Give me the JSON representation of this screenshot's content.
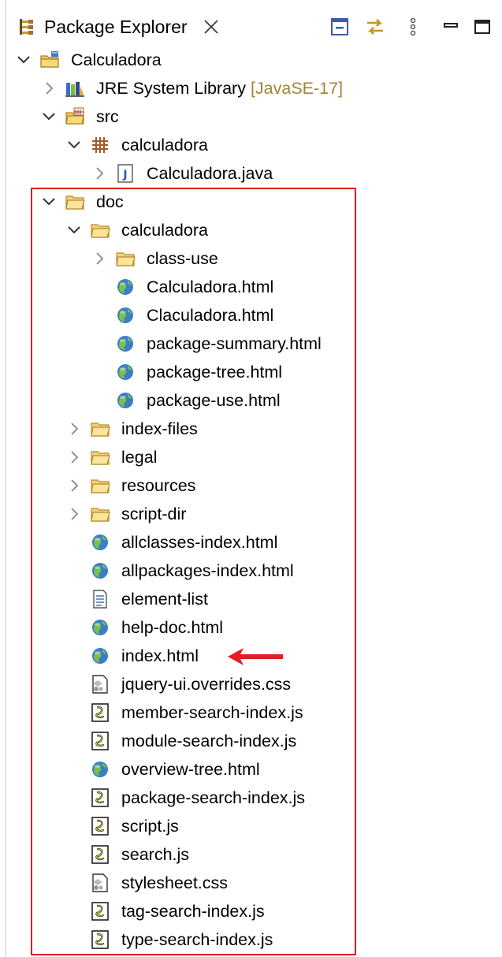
{
  "header": {
    "title": "Package Explorer",
    "icons": [
      "package-explorer-icon",
      "close-icon",
      "collapse-all-icon",
      "link-with-editor-icon",
      "view-menu-icon",
      "minimize-icon",
      "maximize-icon"
    ]
  },
  "tree": [
    {
      "level": 0,
      "expand": "down",
      "icon": "project",
      "label": "Calculadora"
    },
    {
      "level": 1,
      "expand": "right",
      "icon": "library",
      "label": "JRE System Library",
      "decoration": "[JavaSE-17]"
    },
    {
      "level": 1,
      "expand": "down",
      "icon": "src-folder",
      "label": "src"
    },
    {
      "level": 2,
      "expand": "down",
      "icon": "package",
      "label": "calculadora"
    },
    {
      "level": 3,
      "expand": "right",
      "icon": "java",
      "label": "Calculadora.java"
    },
    {
      "level": 1,
      "expand": "down",
      "icon": "folder",
      "label": "doc"
    },
    {
      "level": 2,
      "expand": "down",
      "icon": "folder",
      "label": "calculadora"
    },
    {
      "level": 3,
      "expand": "right",
      "icon": "folder",
      "label": "class-use"
    },
    {
      "level": 3,
      "expand": "",
      "icon": "globe",
      "label": "Calculadora.html"
    },
    {
      "level": 3,
      "expand": "",
      "icon": "globe",
      "label": "Claculadora.html"
    },
    {
      "level": 3,
      "expand": "",
      "icon": "globe",
      "label": "package-summary.html"
    },
    {
      "level": 3,
      "expand": "",
      "icon": "globe",
      "label": "package-tree.html"
    },
    {
      "level": 3,
      "expand": "",
      "icon": "globe",
      "label": "package-use.html"
    },
    {
      "level": 2,
      "expand": "right",
      "icon": "folder",
      "label": "index-files"
    },
    {
      "level": 2,
      "expand": "right",
      "icon": "folder",
      "label": "legal"
    },
    {
      "level": 2,
      "expand": "right",
      "icon": "folder",
      "label": "resources"
    },
    {
      "level": 2,
      "expand": "right",
      "icon": "folder",
      "label": "script-dir"
    },
    {
      "level": 2,
      "expand": "",
      "icon": "globe",
      "label": "allclasses-index.html"
    },
    {
      "level": 2,
      "expand": "",
      "icon": "globe",
      "label": "allpackages-index.html"
    },
    {
      "level": 2,
      "expand": "",
      "icon": "text-file",
      "label": "element-list"
    },
    {
      "level": 2,
      "expand": "",
      "icon": "globe",
      "label": "help-doc.html"
    },
    {
      "level": 2,
      "expand": "",
      "icon": "globe",
      "label": "index.html"
    },
    {
      "level": 2,
      "expand": "",
      "icon": "css",
      "label": "jquery-ui.overrides.css"
    },
    {
      "level": 2,
      "expand": "",
      "icon": "script",
      "label": "member-search-index.js"
    },
    {
      "level": 2,
      "expand": "",
      "icon": "script",
      "label": "module-search-index.js"
    },
    {
      "level": 2,
      "expand": "",
      "icon": "globe",
      "label": "overview-tree.html"
    },
    {
      "level": 2,
      "expand": "",
      "icon": "script",
      "label": "package-search-index.js"
    },
    {
      "level": 2,
      "expand": "",
      "icon": "script",
      "label": "script.js"
    },
    {
      "level": 2,
      "expand": "",
      "icon": "script",
      "label": "search.js"
    },
    {
      "level": 2,
      "expand": "",
      "icon": "css",
      "label": "stylesheet.css"
    },
    {
      "level": 2,
      "expand": "",
      "icon": "script",
      "label": "tag-search-index.js"
    },
    {
      "level": 2,
      "expand": "",
      "icon": "script",
      "label": "type-search-index.js"
    }
  ],
  "annotations": {
    "highlight_box_color": "#e21d23",
    "arrow_color": "#e21d23",
    "arrow_target": "index.html"
  },
  "colors": {
    "decoration": "#a08634",
    "folder": "#e8b84a",
    "globe": "#3a7fc4"
  }
}
